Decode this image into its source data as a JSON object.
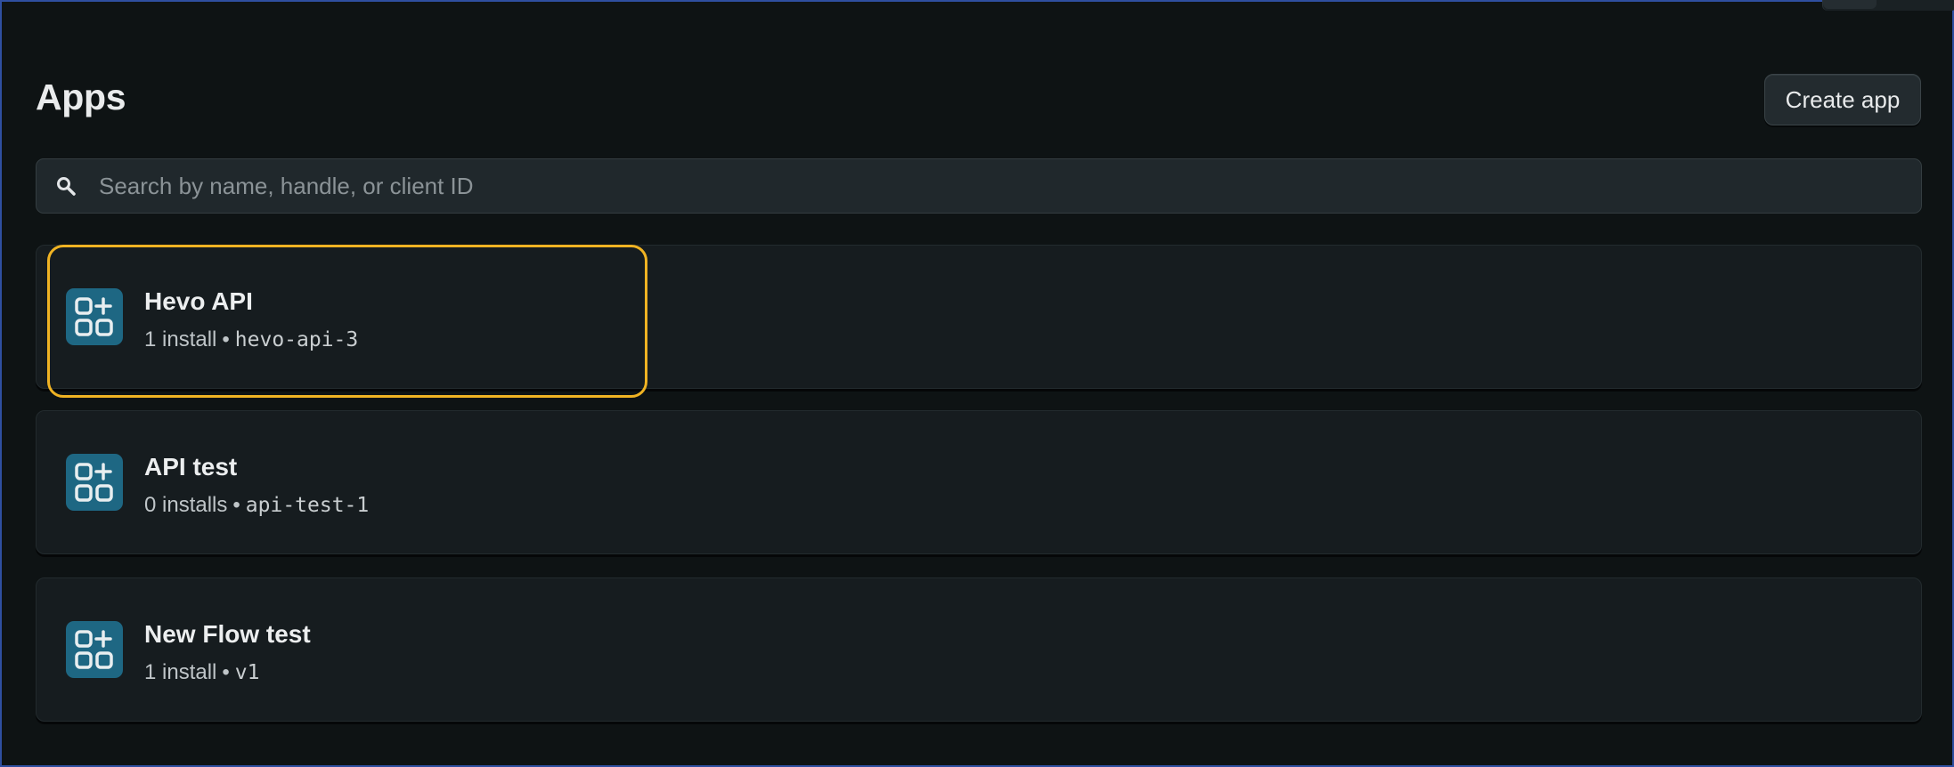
{
  "page": {
    "title": "Apps",
    "create_button_label": "Create app"
  },
  "search": {
    "placeholder": "Search by name, handle, or client ID",
    "value": "",
    "icon": "search-icon"
  },
  "apps": [
    {
      "name": "Hevo API",
      "installs": "1 install",
      "separator": "•",
      "handle": "hevo-api-3",
      "icon": "app-grid-plus-icon",
      "highlighted": true
    },
    {
      "name": "API test",
      "installs": "0 installs",
      "separator": "•",
      "handle": "api-test-1",
      "icon": "app-grid-plus-icon",
      "highlighted": false
    },
    {
      "name": "New Flow test",
      "installs": "1 install",
      "separator": "•",
      "handle": "v1",
      "icon": "app-grid-plus-icon",
      "highlighted": false
    }
  ],
  "colors": {
    "background": "#0e1314",
    "card": "#161c1f",
    "app_icon_bg": "#1e6783",
    "highlight": "#f0b323"
  }
}
